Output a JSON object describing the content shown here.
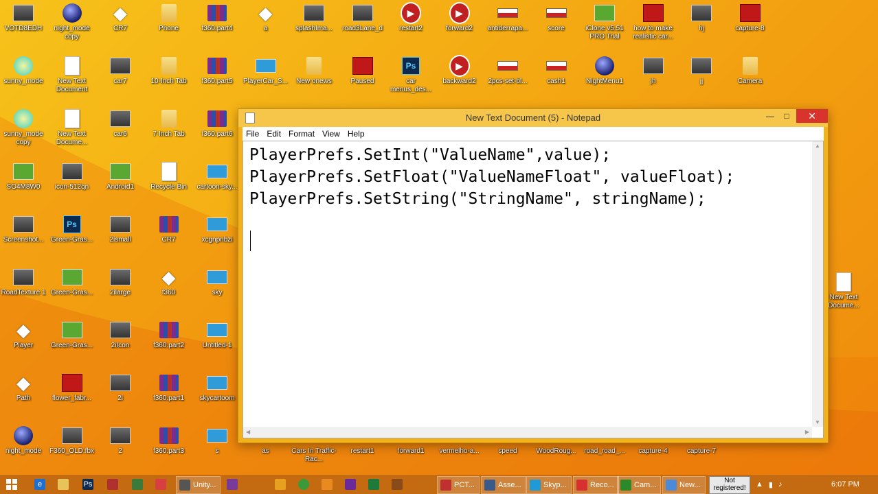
{
  "desktop": {
    "icons": [
      {
        "label": "VOTD8EDH",
        "type": "img"
      },
      {
        "label": "night_mode copy",
        "type": "ball"
      },
      {
        "label": "CR7",
        "type": "unity"
      },
      {
        "label": "Phone",
        "type": "folder"
      },
      {
        "label": "f360.part4",
        "type": "rar"
      },
      {
        "label": "a",
        "type": "unity"
      },
      {
        "label": "splashIma...",
        "type": "img"
      },
      {
        "label": "road3Lane_d",
        "type": "img"
      },
      {
        "label": "restart2",
        "type": "circle"
      },
      {
        "label": "forward2",
        "type": "circle"
      },
      {
        "label": "antiderrapa...",
        "type": "strip"
      },
      {
        "label": "score",
        "type": "strip"
      },
      {
        "label": "iClone v5.51 PRO Trial",
        "type": "green"
      },
      {
        "label": "how to make realistic car...",
        "type": "red"
      },
      {
        "label": "hj",
        "type": "img"
      },
      {
        "label": "capture-8",
        "type": "red"
      },
      {
        "label": "sunny_mode",
        "type": "light"
      },
      {
        "label": "New Text Document",
        "type": "doc"
      },
      {
        "label": "car7",
        "type": "img"
      },
      {
        "label": "10-Inch Tab",
        "type": "folder"
      },
      {
        "label": "f360.part5",
        "type": "rar"
      },
      {
        "label": "PlayerCar_S...",
        "type": "blue"
      },
      {
        "label": "New onews",
        "type": "folder"
      },
      {
        "label": "Paused",
        "type": "red"
      },
      {
        "label": "car menus_des...",
        "type": "ps"
      },
      {
        "label": "backward2",
        "type": "circle"
      },
      {
        "label": "2pcs-set-bl...",
        "type": "strip"
      },
      {
        "label": "cash1",
        "type": "strip"
      },
      {
        "label": "NightMenu1",
        "type": "ball"
      },
      {
        "label": "jh",
        "type": "img"
      },
      {
        "label": "jj",
        "type": "img"
      },
      {
        "label": "Camera",
        "type": "folder"
      },
      {
        "label": "sunny_mode copy",
        "type": "light"
      },
      {
        "label": "New Text Docume...",
        "type": "doc"
      },
      {
        "label": "car6",
        "type": "img"
      },
      {
        "label": "7-Inch Tab",
        "type": "folder"
      },
      {
        "label": "f360.part6",
        "type": "rar"
      },
      {
        "label": "SO4M8W0",
        "type": "green"
      },
      {
        "label": "icon-512qn",
        "type": "img"
      },
      {
        "label": "Android1",
        "type": "green"
      },
      {
        "label": "Recycle Bin",
        "type": "doc"
      },
      {
        "label": "cartoon-sky...",
        "type": "blue"
      },
      {
        "label": "Screenshot...",
        "type": "img"
      },
      {
        "label": "Green-Gras...",
        "type": "ps"
      },
      {
        "label": "2ismall",
        "type": "img"
      },
      {
        "label": "CR7",
        "type": "rar"
      },
      {
        "label": "xcgnpnbzi",
        "type": "blue"
      },
      {
        "label": "RoadTexture 1",
        "type": "img"
      },
      {
        "label": "Green-Gras...",
        "type": "green"
      },
      {
        "label": "2ilarge",
        "type": "img"
      },
      {
        "label": "f360",
        "type": "unity"
      },
      {
        "label": "sky",
        "type": "blue"
      },
      {
        "label": "Player",
        "type": "unity"
      },
      {
        "label": "Green-Gras...",
        "type": "green"
      },
      {
        "label": "2iIcon",
        "type": "img"
      },
      {
        "label": "f360.part2",
        "type": "rar"
      },
      {
        "label": "Untitled-1",
        "type": "blue"
      },
      {
        "label": "Path",
        "type": "unity"
      },
      {
        "label": "flower_fabr...",
        "type": "red"
      },
      {
        "label": "2i",
        "type": "img"
      },
      {
        "label": "f360.part1",
        "type": "rar"
      },
      {
        "label": "skycartoom",
        "type": "blue"
      },
      {
        "label": "night_mode",
        "type": "ball"
      },
      {
        "label": "F360_OLD.fbx",
        "type": "img"
      },
      {
        "label": "2",
        "type": "img"
      },
      {
        "label": "f360.part3",
        "type": "rar"
      },
      {
        "label": "s",
        "type": "blue"
      },
      {
        "label": "as",
        "type": "none"
      },
      {
        "label": "Cars In Traffic-Rac...",
        "type": "none"
      },
      {
        "label": "restart1",
        "type": "none"
      },
      {
        "label": "forward1",
        "type": "none"
      },
      {
        "label": "vermelho-a...",
        "type": "none"
      },
      {
        "label": "speed",
        "type": "none"
      },
      {
        "label": "WoodRoug...",
        "type": "none"
      },
      {
        "label": "road_road_...",
        "type": "none"
      },
      {
        "label": "capture-4",
        "type": "none"
      },
      {
        "label": "capture-7",
        "type": "none"
      },
      {
        "label": "New Text Docume...",
        "type": "doc"
      }
    ]
  },
  "notepad": {
    "title": "New Text Document (5) - Notepad",
    "menu": [
      "File",
      "Edit",
      "Format",
      "View",
      "Help"
    ],
    "lines": [
      "PlayerPrefs.SetInt(\"ValueName\",value);",
      "PlayerPrefs.SetFloat(\"ValueNameFloat\", valueFloat);",
      "PlayerPrefs.SetString(\"StringName\", stringName);"
    ],
    "minimize": "—",
    "maximize": "□",
    "close": "✕"
  },
  "taskbar": {
    "items": [
      {
        "label": "Unity...",
        "icon": "unity-icon",
        "color": "#555555"
      },
      {
        "label": "PCT...",
        "icon": "pct-icon",
        "color": "#c03030"
      },
      {
        "label": "Asse...",
        "icon": "assets-icon",
        "color": "#3a5a8a"
      },
      {
        "label": "Skyp...",
        "icon": "skype-icon",
        "color": "#1e9ad6"
      },
      {
        "label": "Reco...",
        "icon": "record-icon",
        "color": "#d83030"
      },
      {
        "label": "Cam...",
        "icon": "camtasia-icon",
        "color": "#2a8a2a"
      },
      {
        "label": "New...",
        "icon": "notepad-icon",
        "color": "#4a8ad8"
      }
    ],
    "not_registered": "Not registered!",
    "clock": "6:07 PM"
  }
}
